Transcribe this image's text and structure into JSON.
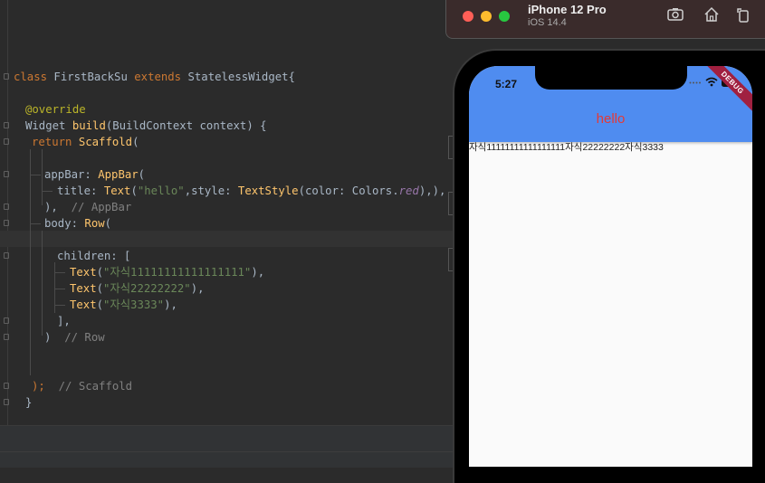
{
  "editor": {
    "lines": [
      {
        "tokens": [
          {
            "t": "class ",
            "c": "kw"
          },
          {
            "t": "FirstBackSu ",
            "c": "plain"
          },
          {
            "t": "extends ",
            "c": "kw"
          },
          {
            "t": "StatelessWidget{",
            "c": "plain"
          }
        ]
      },
      {
        "tokens": [
          {
            "t": "@override",
            "c": "anno"
          }
        ]
      },
      {
        "tokens": [
          {
            "t": "Widget ",
            "c": "plain"
          },
          {
            "t": "build",
            "c": "cls"
          },
          {
            "t": "(BuildContext context) {",
            "c": "plain"
          }
        ]
      },
      {
        "tokens": [
          {
            "t": "return ",
            "c": "kw"
          },
          {
            "t": "Scaffold",
            "c": "cls"
          },
          {
            "t": "(",
            "c": "plain"
          }
        ]
      },
      {
        "tokens": [
          {
            "t": "appBar: ",
            "c": "plain"
          },
          {
            "t": "AppBar",
            "c": "cls"
          },
          {
            "t": "(",
            "c": "plain"
          }
        ]
      },
      {
        "tokens": [
          {
            "t": "title: ",
            "c": "plain"
          },
          {
            "t": "Text",
            "c": "cls"
          },
          {
            "t": "(",
            "c": "plain"
          },
          {
            "t": "\"hello\"",
            "c": "str"
          },
          {
            "t": ",style: ",
            "c": "plain"
          },
          {
            "t": "TextStyle",
            "c": "cls"
          },
          {
            "t": "(color: Colors.",
            "c": "plain"
          },
          {
            "t": "red",
            "c": "ital"
          },
          {
            "t": "),),",
            "c": "plain"
          }
        ]
      },
      {
        "tokens": [
          {
            "t": "),  ",
            "c": "plain"
          },
          {
            "t": "// AppBar",
            "c": "cmt"
          }
        ]
      },
      {
        "tokens": [
          {
            "t": "body: ",
            "c": "plain"
          },
          {
            "t": "Row",
            "c": "cls"
          },
          {
            "t": "(",
            "c": "plain"
          }
        ]
      },
      {
        "tokens": [
          {
            "t": "children: [",
            "c": "plain"
          }
        ]
      },
      {
        "tokens": [
          {
            "t": "Text",
            "c": "cls"
          },
          {
            "t": "(",
            "c": "plain"
          },
          {
            "t": "\"자식11111111111111111\"",
            "c": "str"
          },
          {
            "t": "),",
            "c": "plain"
          }
        ]
      },
      {
        "tokens": [
          {
            "t": "Text",
            "c": "cls"
          },
          {
            "t": "(",
            "c": "plain"
          },
          {
            "t": "\"자식22222222\"",
            "c": "str"
          },
          {
            "t": "),",
            "c": "plain"
          }
        ]
      },
      {
        "tokens": [
          {
            "t": "Text",
            "c": "cls"
          },
          {
            "t": "(",
            "c": "plain"
          },
          {
            "t": "\"자식3333\"",
            "c": "str"
          },
          {
            "t": "),",
            "c": "plain"
          }
        ]
      },
      {
        "tokens": [
          {
            "t": "],",
            "c": "plain"
          }
        ]
      },
      {
        "tokens": [
          {
            "t": ")  ",
            "c": "plain"
          },
          {
            "t": "// Row",
            "c": "cmt"
          }
        ]
      },
      {
        "tokens": [
          {
            "t": ");  ",
            "c": "kw"
          },
          {
            "t": "// Scaffold",
            "c": "cmt"
          }
        ]
      },
      {
        "tokens": [
          {
            "t": "}",
            "c": "plain"
          }
        ]
      }
    ]
  },
  "simulator": {
    "device_name": "iPhone 12 Pro",
    "os_version": "iOS 14.4",
    "toolbar_icons": [
      "screenshot-icon",
      "home-icon",
      "rotate-icon"
    ],
    "traffic_lights": [
      "#ff5f57",
      "#febc2e",
      "#28c840"
    ]
  },
  "app": {
    "status_time": "5:27",
    "appbar_title": "hello",
    "appbar_color": "#4f8cf0",
    "title_color": "#e53935",
    "debug_banner": "DEBUG",
    "row_texts": [
      "자식11111111111111111",
      "자식22222222",
      "자식3333"
    ]
  }
}
